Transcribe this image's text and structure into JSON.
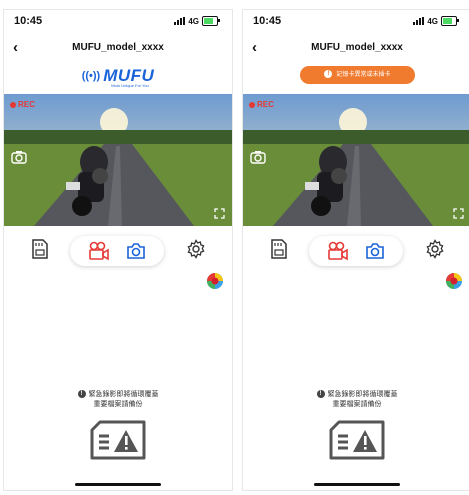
{
  "status_bar": {
    "time": "10:45",
    "network": "4G"
  },
  "nav": {
    "back_label": "‹",
    "title": "MUFU_model_xxxx"
  },
  "logo": {
    "brand": "MUFU",
    "tagline": "Moto Unique For You",
    "wifi": "((•))"
  },
  "warning_pill": {
    "icon": "!",
    "text": "記憶卡異常或未插卡"
  },
  "video": {
    "rec_label": "REC"
  },
  "notice": {
    "icon": "!",
    "line1": "緊急錄影即將循環覆蓋",
    "line2": "重要檔案請備份"
  },
  "colors": {
    "accent": "#1a63d8",
    "record": "#e53935",
    "warning": "#f07a2e"
  },
  "icons": {
    "flip_camera": "flip-camera-icon",
    "fullscreen": "fullscreen-icon",
    "sd_card": "sd-card-file-icon",
    "record_video": "record-video-icon",
    "photo": "photo-camera-icon",
    "settings": "gear-icon",
    "color_ball": "color-ball-icon",
    "card_warning": "card-warning-icon"
  }
}
